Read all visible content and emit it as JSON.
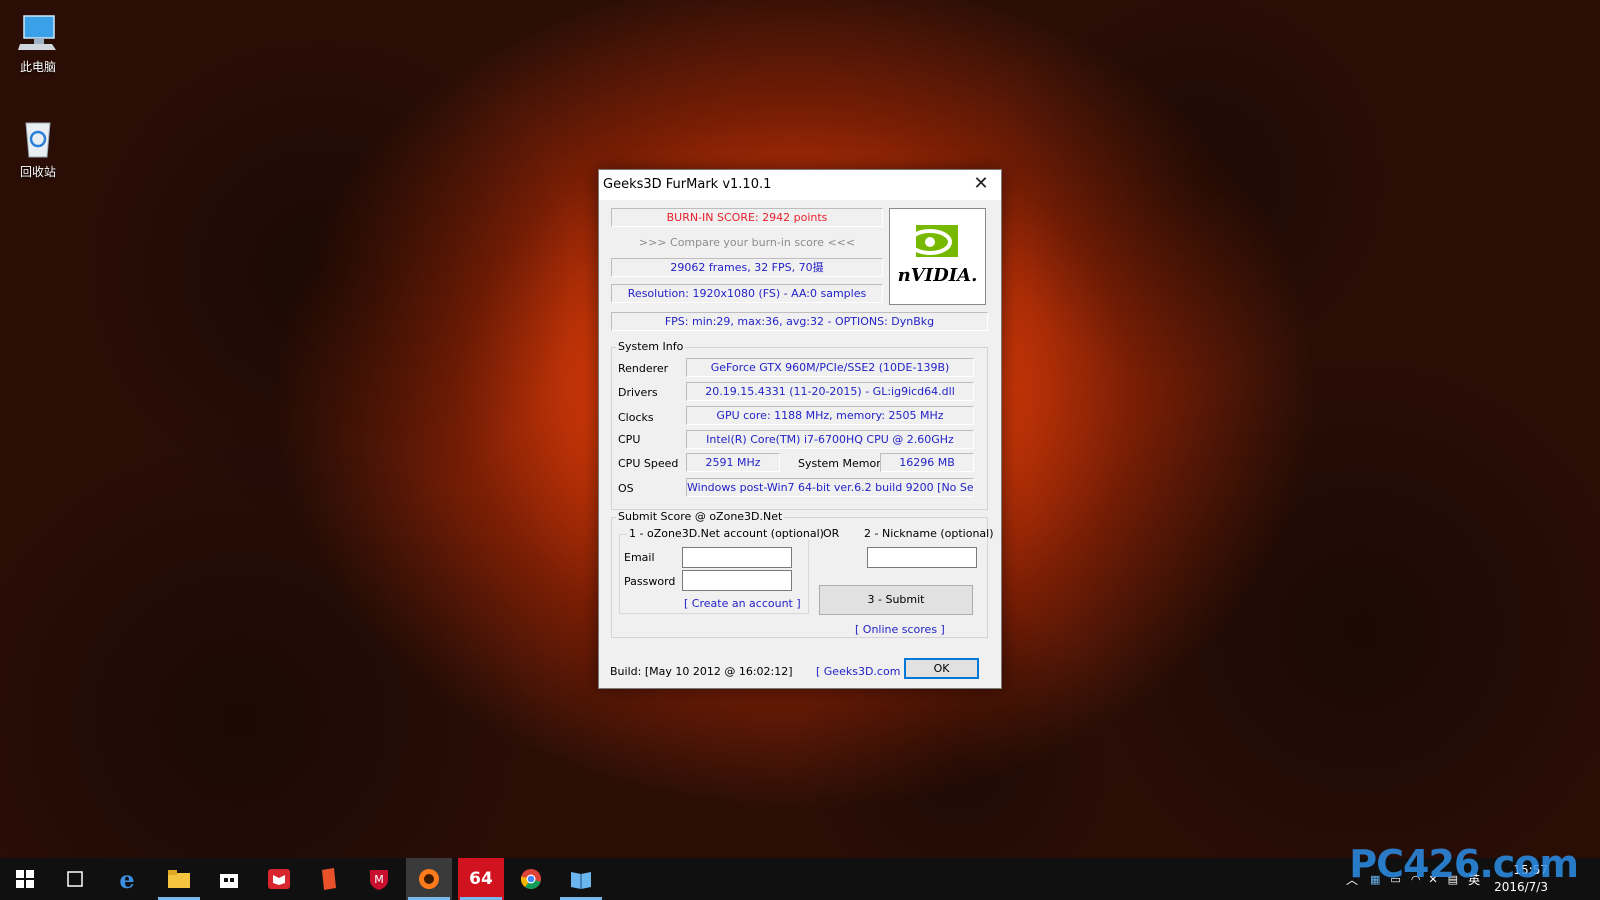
{
  "desktop": {
    "icons": [
      {
        "label": "此电脑"
      },
      {
        "label": "回收站"
      }
    ]
  },
  "dialog": {
    "title": "Geeks3D FurMark v1.10.1",
    "burn_in_score": "BURN-IN SCORE: 2942 points",
    "compare": ">>> Compare your burn-in score <<<",
    "frames": "29062 frames, 32 FPS, 70摄",
    "resolution": "Resolution: 1920x1080 (FS) - AA:0 samples",
    "fps": "FPS: min:29, max:36, avg:32 - OPTIONS: DynBkg",
    "logo_text": "nVIDIA.",
    "system_info": {
      "group_label": "System Info",
      "renderer_label": "Renderer",
      "renderer": "GeForce GTX 960M/PCIe/SSE2 (10DE-139B)",
      "drivers_label": "Drivers",
      "drivers": "20.19.15.4331 (11-20-2015) - GL:ig9icd64.dll",
      "clocks_label": "Clocks",
      "clocks": "GPU core: 1188 MHz, memory: 2505 MHz",
      "cpu_label": "CPU",
      "cpu": "Intel(R) Core(TM) i7-6700HQ CPU @ 2.60GHz",
      "cpu_speed_label": "CPU Speed",
      "cpu_speed": "2591 MHz",
      "memory_label": "System Memory",
      "memory": "16296 MB",
      "os_label": "OS",
      "os": "Windows post-Win7 64-bit ver.6.2 build 9200 [No Service"
    },
    "submit": {
      "group_label": "Submit Score @ oZone3D.Net",
      "account_label": "1 - oZone3D.Net account (optional)",
      "or_label": "OR",
      "nickname_label": "2 - Nickname (optional)",
      "email_label": "Email",
      "password_label": "Password",
      "email_value": "",
      "password_value": "",
      "nickname_value": "",
      "create_account": "[ Create an account ]",
      "submit_button": "3 - Submit",
      "online_scores": "[ Online scores ]"
    },
    "build": "Build: [May 10 2012 @ 16:02:12]",
    "geeks3d_link": "[ Geeks3D.com ]",
    "ok_button": "OK"
  },
  "taskbar": {
    "apps": [
      "start-icon",
      "task-view-icon",
      "edge-icon",
      "file-explorer-icon",
      "store-icon",
      "reader-icon",
      "app-icon",
      "mcafee-icon",
      "furmark-icon",
      "aida64-icon",
      "chrome-icon",
      "book-icon"
    ],
    "aida_label": "64",
    "ime": "英",
    "time": "15:57",
    "date": "2016/7/3"
  },
  "watermark": "PC426.com"
}
